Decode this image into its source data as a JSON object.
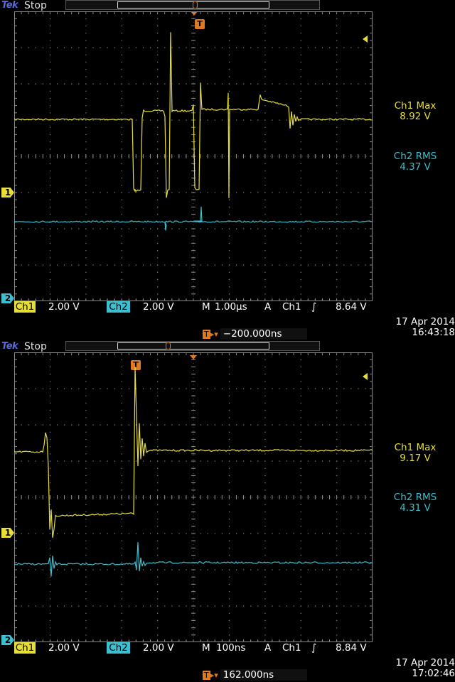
{
  "scopes": [
    {
      "brand": "Tek",
      "run_state": "Stop",
      "ch1_label": "1",
      "ch2_label": "2",
      "trigger_marker": "T",
      "measurements": [
        {
          "name": "Ch1 Max",
          "value": "8.92 V"
        },
        {
          "name": "Ch2 RMS",
          "value": "4.37 V"
        }
      ],
      "bottom": {
        "ch1": "Ch1",
        "ch1_scale": "2.00 V",
        "ch2": "Ch2",
        "ch2_scale": "2.00 V",
        "timebase_prefix": "M",
        "timebase": "1.00µs",
        "trig_mode": "A",
        "trig_source": "Ch1",
        "trig_slope": "∫",
        "trig_level": "8.64 V"
      },
      "trigger_position": {
        "marker": "T",
        "arrow": "▸▾",
        "value": "−200.000ns"
      },
      "date": "17 Apr  2014",
      "time": "16:43:18"
    },
    {
      "brand": "Tek",
      "run_state": "Stop",
      "ch1_label": "1",
      "ch2_label": "2",
      "trigger_marker": "T",
      "measurements": [
        {
          "name": "Ch1 Max",
          "value": "9.17 V"
        },
        {
          "name": "Ch2 RMS",
          "value": "4.31 V"
        }
      ],
      "bottom": {
        "ch1": "Ch1",
        "ch1_scale": "2.00 V",
        "ch2": "Ch2",
        "ch2_scale": "2.00 V",
        "timebase_prefix": "M",
        "timebase": "100ns",
        "trig_mode": "A",
        "trig_source": "Ch1",
        "trig_slope": "∫",
        "trig_level": "8.84 V"
      },
      "trigger_position": {
        "marker": "T",
        "arrow": "▸▾",
        "value": "162.000ns"
      },
      "date": "17 Apr  2014",
      "time": "17:02:46"
    }
  ],
  "colors": {
    "ch1": "#e8df35",
    "ch2": "#3cbfcf",
    "trigger": "#e07a20",
    "grid": "#8a8a8a"
  }
}
